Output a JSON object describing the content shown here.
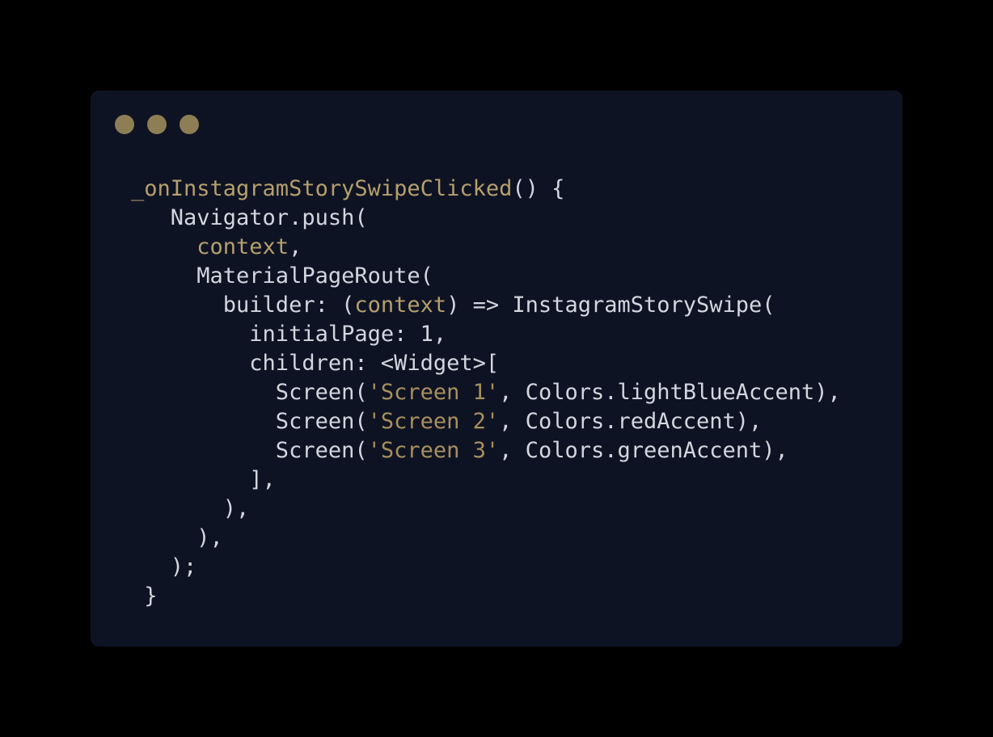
{
  "window": {
    "controls": [
      "close-dot",
      "minimize-dot",
      "maximize-dot"
    ],
    "dot_color": "#8e7e55",
    "background": "#0e1324"
  },
  "code": {
    "lines": [
      [
        {
          "t": "_onInstagramStorySwipeClicked",
          "k": "fn"
        },
        {
          "t": "() {",
          "k": "plain"
        }
      ],
      [
        {
          "t": "   Navigator.push(",
          "k": "plain"
        }
      ],
      [
        {
          "t": "     ",
          "k": "plain"
        },
        {
          "t": "context",
          "k": "ctx"
        },
        {
          "t": ",",
          "k": "plain"
        }
      ],
      [
        {
          "t": "     MaterialPageRoute(",
          "k": "plain"
        }
      ],
      [
        {
          "t": "       builder: (",
          "k": "plain"
        },
        {
          "t": "context",
          "k": "ctx"
        },
        {
          "t": ") => InstagramStorySwipe(",
          "k": "plain"
        }
      ],
      [
        {
          "t": "         initialPage: 1,",
          "k": "plain"
        }
      ],
      [
        {
          "t": "         children: <Widget>[",
          "k": "plain"
        }
      ],
      [
        {
          "t": "           Screen(",
          "k": "plain"
        },
        {
          "t": "'Screen 1'",
          "k": "str"
        },
        {
          "t": ", Colors.lightBlueAccent),",
          "k": "plain"
        }
      ],
      [
        {
          "t": "           Screen(",
          "k": "plain"
        },
        {
          "t": "'Screen 2'",
          "k": "str"
        },
        {
          "t": ", Colors.redAccent),",
          "k": "plain"
        }
      ],
      [
        {
          "t": "           Screen(",
          "k": "plain"
        },
        {
          "t": "'Screen 3'",
          "k": "str"
        },
        {
          "t": ", Colors.greenAccent),",
          "k": "plain"
        }
      ],
      [
        {
          "t": "         ],",
          "k": "plain"
        }
      ],
      [
        {
          "t": "       ),",
          "k": "plain"
        }
      ],
      [
        {
          "t": "     ),",
          "k": "plain"
        }
      ],
      [
        {
          "t": "   );",
          "k": "plain"
        }
      ],
      [
        {
          "t": " }",
          "k": "plain"
        }
      ]
    ]
  },
  "colors": {
    "function_name": "#b59f6c",
    "string": "#a88f5c",
    "identifier": "#b59f6c",
    "default_text": "#d2d6de"
  }
}
